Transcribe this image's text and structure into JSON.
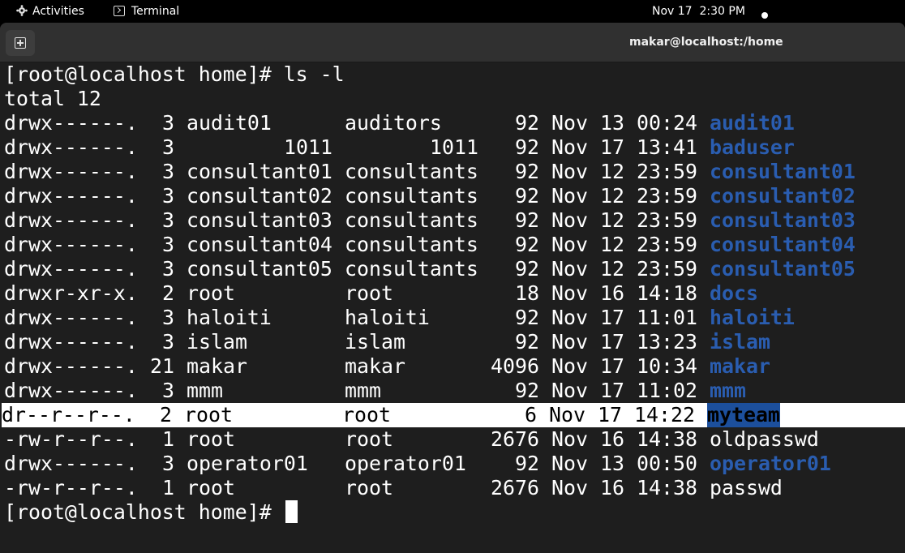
{
  "topbar": {
    "activities": "Activities",
    "app": "Terminal",
    "date": "Nov 17",
    "time": "2:30 PM"
  },
  "window": {
    "title": "makar@localhost:/home"
  },
  "terminal": {
    "prompt": "[root@localhost home]# ",
    "command": "ls -l",
    "total": "total 12",
    "rows": [
      {
        "perm": "drwx------.",
        "links": "3",
        "owner": "audit01",
        "group": "auditors",
        "size": "92",
        "mon": "Nov",
        "day": "13",
        "time": "00:24",
        "name": "audit01",
        "type": "dir"
      },
      {
        "perm": "drwx------.",
        "links": "3",
        "owner": "1011",
        "group": "1011",
        "size": "92",
        "mon": "Nov",
        "day": "17",
        "time": "13:41",
        "name": "baduser",
        "type": "dir",
        "numeric": true
      },
      {
        "perm": "drwx------.",
        "links": "3",
        "owner": "consultant01",
        "group": "consultants",
        "size": "92",
        "mon": "Nov",
        "day": "12",
        "time": "23:59",
        "name": "consultant01",
        "type": "dir"
      },
      {
        "perm": "drwx------.",
        "links": "3",
        "owner": "consultant02",
        "group": "consultants",
        "size": "92",
        "mon": "Nov",
        "day": "12",
        "time": "23:59",
        "name": "consultant02",
        "type": "dir"
      },
      {
        "perm": "drwx------.",
        "links": "3",
        "owner": "consultant03",
        "group": "consultants",
        "size": "92",
        "mon": "Nov",
        "day": "12",
        "time": "23:59",
        "name": "consultant03",
        "type": "dir"
      },
      {
        "perm": "drwx------.",
        "links": "3",
        "owner": "consultant04",
        "group": "consultants",
        "size": "92",
        "mon": "Nov",
        "day": "12",
        "time": "23:59",
        "name": "consultant04",
        "type": "dir"
      },
      {
        "perm": "drwx------.",
        "links": "3",
        "owner": "consultant05",
        "group": "consultants",
        "size": "92",
        "mon": "Nov",
        "day": "12",
        "time": "23:59",
        "name": "consultant05",
        "type": "dir"
      },
      {
        "perm": "drwxr-xr-x.",
        "links": "2",
        "owner": "root",
        "group": "root",
        "size": "18",
        "mon": "Nov",
        "day": "16",
        "time": "14:18",
        "name": "docs",
        "type": "dir"
      },
      {
        "perm": "drwx------.",
        "links": "3",
        "owner": "haloiti",
        "group": "haloiti",
        "size": "92",
        "mon": "Nov",
        "day": "17",
        "time": "11:01",
        "name": "haloiti",
        "type": "dir"
      },
      {
        "perm": "drwx------.",
        "links": "3",
        "owner": "islam",
        "group": "islam",
        "size": "92",
        "mon": "Nov",
        "day": "17",
        "time": "13:23",
        "name": "islam",
        "type": "dir"
      },
      {
        "perm": "drwx------.",
        "links": "21",
        "owner": "makar",
        "group": "makar",
        "size": "4096",
        "mon": "Nov",
        "day": "17",
        "time": "10:34",
        "name": "makar",
        "type": "dir"
      },
      {
        "perm": "drwx------.",
        "links": "3",
        "owner": "mmm",
        "group": "mmm",
        "size": "92",
        "mon": "Nov",
        "day": "17",
        "time": "11:02",
        "name": "mmm",
        "type": "dir"
      },
      {
        "perm": "dr--r--r--.",
        "links": "2",
        "owner": "root",
        "group": "root",
        "size": "6",
        "mon": "Nov",
        "day": "17",
        "time": "14:22",
        "name": "myteam",
        "type": "dir",
        "highlighted": true
      },
      {
        "perm": "-rw-r--r--.",
        "links": "1",
        "owner": "root",
        "group": "root",
        "size": "2676",
        "mon": "Nov",
        "day": "16",
        "time": "14:38",
        "name": "oldpasswd",
        "type": "file"
      },
      {
        "perm": "drwx------.",
        "links": "3",
        "owner": "operator01",
        "group": "operator01",
        "size": "92",
        "mon": "Nov",
        "day": "13",
        "time": "00:50",
        "name": "operator01",
        "type": "dir"
      },
      {
        "perm": "-rw-r--r--.",
        "links": "1",
        "owner": "root",
        "group": "root",
        "size": "2676",
        "mon": "Nov",
        "day": "16",
        "time": "14:38",
        "name": "passwd",
        "type": "file"
      }
    ]
  },
  "colors": {
    "dir": "#2a5db0",
    "highlight_bg": "#ffffff",
    "terminal_bg": "#1e1e1e"
  }
}
